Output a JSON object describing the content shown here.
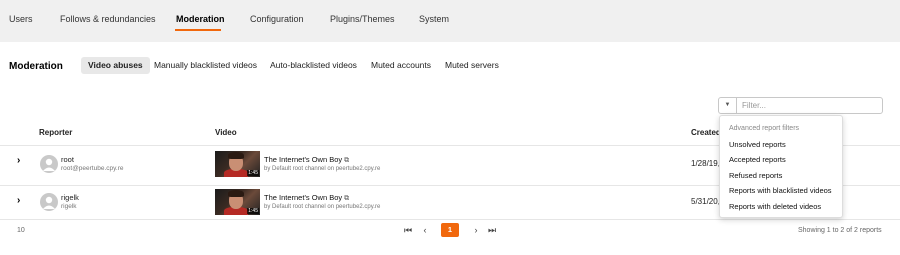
{
  "topnav": {
    "tabs": [
      {
        "label": "Users"
      },
      {
        "label": "Follows & redundancies"
      },
      {
        "label": "Moderation"
      },
      {
        "label": "Configuration"
      },
      {
        "label": "Plugins/Themes"
      },
      {
        "label": "System"
      }
    ],
    "active": "Moderation"
  },
  "page": {
    "title": "Moderation",
    "subtabs": [
      {
        "label": "Video abuses"
      },
      {
        "label": "Manually blacklisted videos"
      },
      {
        "label": "Auto-blacklisted videos"
      },
      {
        "label": "Muted accounts"
      },
      {
        "label": "Muted servers"
      }
    ],
    "active_subtab": "Video abuses"
  },
  "filter": {
    "placeholder": "Filter...",
    "value": "",
    "caret_icon": "caret-down-icon"
  },
  "table": {
    "columns": [
      "Reporter",
      "Video",
      "Created"
    ],
    "rows": [
      {
        "reporter_name": "root",
        "reporter_handle": "root@peertube.cpy.re",
        "video_title": "The Internet's Own Boy",
        "video_by": "by Default root channel on peertube2.cpy.re",
        "video_duration": "1:45",
        "created": "1/28/19,"
      },
      {
        "reporter_name": "rigelk",
        "reporter_handle": "rigelk",
        "video_title": "The Internet's Own Boy",
        "video_by": "by Default root channel on peertube2.cpy.re",
        "video_duration": "1:45",
        "created": "5/31/20,"
      }
    ]
  },
  "dropdown": {
    "header": "Advanced report filters",
    "items": [
      "Unsolved reports",
      "Accepted reports",
      "Refused reports",
      "Reports with blacklisted videos",
      "Reports with deleted videos"
    ]
  },
  "footer": {
    "rows_per_page": "10",
    "current_page": "1",
    "summary": "Showing 1 to 2 of 2 reports"
  },
  "colors": {
    "accent": "#f1680d",
    "topnav_bg": "#f0f0f0"
  }
}
